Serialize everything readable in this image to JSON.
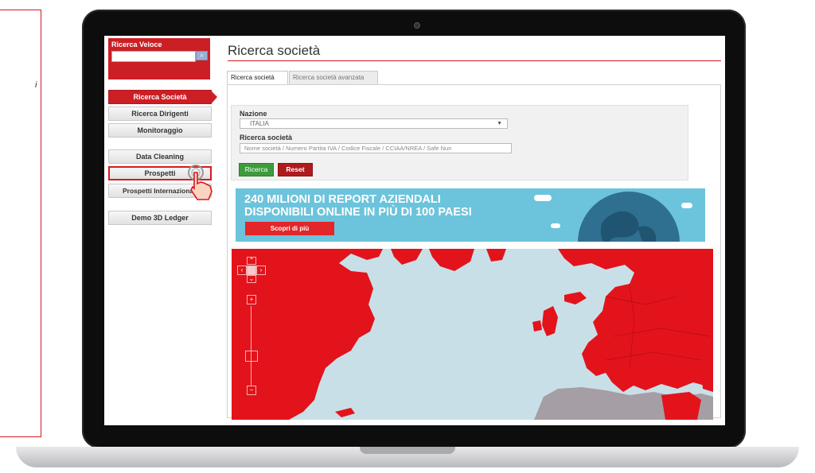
{
  "left_fragment": "i",
  "sidebar": {
    "search_title": "Ricerca Veloce",
    "items": [
      {
        "label": "Ricerca Società"
      },
      {
        "label": "Ricerca Dirigenti"
      },
      {
        "label": "Monitoraggio"
      },
      {
        "label": "Data Cleaning"
      },
      {
        "label": "Prospetti"
      },
      {
        "label": "Prospetti Internazionali"
      },
      {
        "label": "Demo 3D Ledger"
      }
    ]
  },
  "main": {
    "title": "Ricerca società",
    "tabs": [
      {
        "label": "Ricerca società"
      },
      {
        "label": "Ricerca società avanzata"
      }
    ],
    "form": {
      "nazione_label": "Nazione",
      "nazione_value": "ITALIA",
      "ricerca_label": "Ricerca società",
      "ricerca_placeholder": "Nome società / Numero Partita IVA / Codice Fiscale / CCIAA/NREA / Safe Nun",
      "search_button": "Ricerca",
      "reset_button": "Reset"
    },
    "banner": {
      "line1": "240 MILIONI DI REPORT AZIENDALI",
      "line2": "DISPONIBILI ONLINE IN PIÙ DI 100 PAESI",
      "cta": "Scopri di più"
    }
  },
  "colors": {
    "brand_red": "#cc1f25",
    "banner_blue": "#6cc3dc",
    "map_land_red": "#e3131b",
    "map_sea": "#c9dfe8",
    "map_land_grey": "#a59ea4",
    "search_green": "#3f9a3f"
  },
  "icons": [
    "search-icon",
    "pointer-hand-icon",
    "dropdown-arrow-icon",
    "globe-icon",
    "pan-icon",
    "zoom-in-icon",
    "zoom-out-icon"
  ]
}
